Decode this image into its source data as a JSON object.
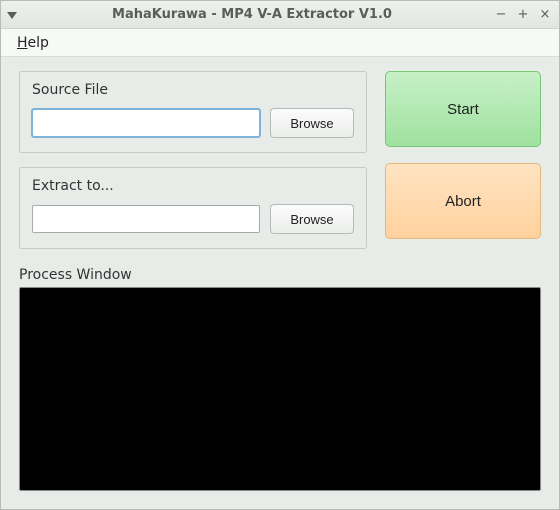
{
  "window": {
    "title": "MahaKurawa - MP4 V-A Extractor V1.0"
  },
  "menubar": {
    "help_prefix": "H",
    "help_rest": "elp"
  },
  "source": {
    "label": "Source File",
    "value": "",
    "browse": "Browse"
  },
  "extract": {
    "label": "Extract to...",
    "value": "",
    "browse": "Browse"
  },
  "actions": {
    "start": "Start",
    "abort": "Abort"
  },
  "process": {
    "label": "Process Window",
    "output": ""
  }
}
